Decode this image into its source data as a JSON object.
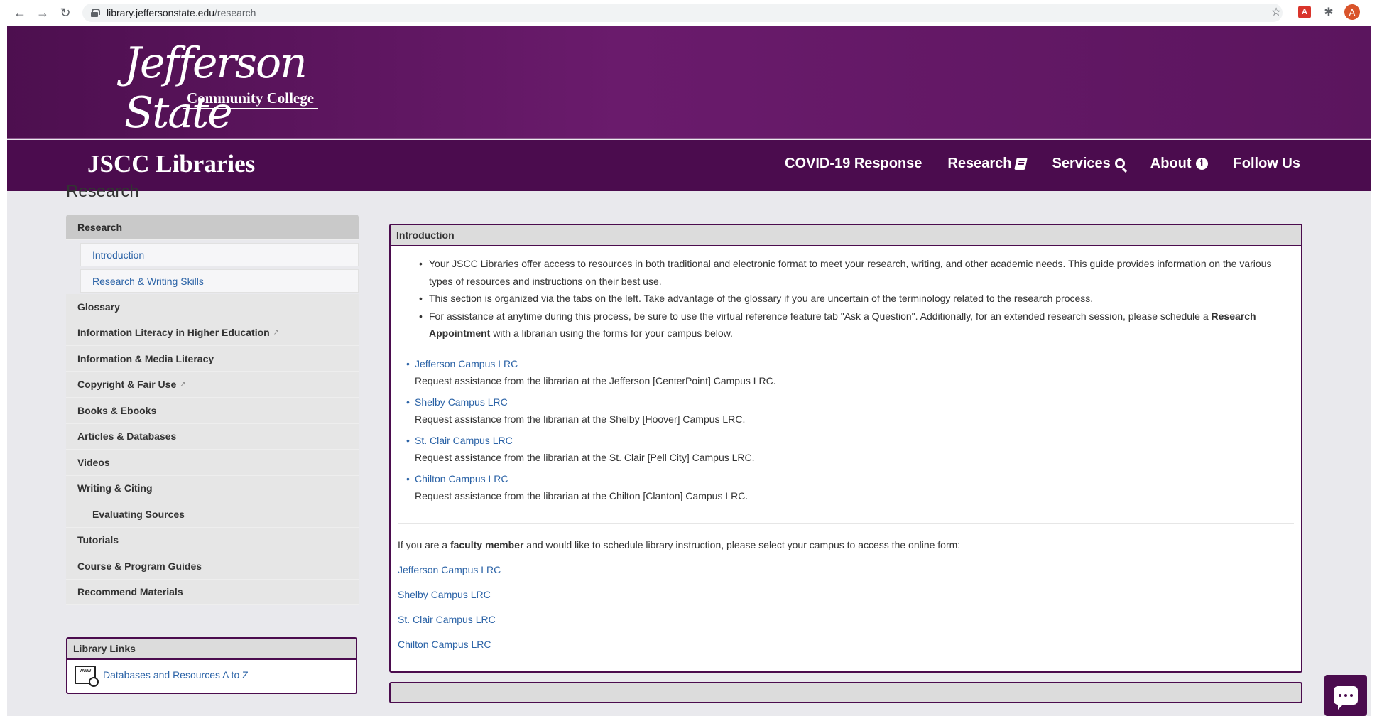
{
  "browser": {
    "url_host": "library.jeffersonstate.edu",
    "url_path": "/research",
    "back_icon": "arrow-left-icon",
    "forward_icon": "arrow-right-icon",
    "reload_icon": "reload-icon",
    "avatar_letter": "A",
    "pdf_ext": "A"
  },
  "header": {
    "logo_script": "Jefferson State",
    "logo_sub": "Community College",
    "brand": "JSCC Libraries",
    "nav": [
      {
        "label": "COVID-19 Response"
      },
      {
        "label": "Research"
      },
      {
        "label": "Services"
      },
      {
        "label": "About"
      },
      {
        "label": "Follow Us"
      }
    ],
    "brand_color": "#4b0c4e"
  },
  "page": {
    "title": "Research"
  },
  "sidenav": {
    "items": [
      {
        "label": "Research"
      },
      {
        "label": "Introduction"
      },
      {
        "label": "Research & Writing Skills"
      },
      {
        "label": "Glossary"
      },
      {
        "label": "Information Literacy in Higher Education"
      },
      {
        "label": "Information & Media Literacy"
      },
      {
        "label": "Copyright & Fair Use"
      },
      {
        "label": "Books & Ebooks"
      },
      {
        "label": "Articles & Databases"
      },
      {
        "label": "Videos"
      },
      {
        "label": "Writing & Citing"
      },
      {
        "label": "Evaluating Sources"
      },
      {
        "label": "Tutorials"
      },
      {
        "label": "Course & Program Guides"
      },
      {
        "label": "Recommend Materials"
      }
    ]
  },
  "library_links": {
    "title": "Library Links",
    "items": [
      {
        "label": "Databases and Resources A to Z",
        "icon_text": "www"
      }
    ]
  },
  "intro": {
    "title": "Introduction",
    "bullets": [
      "Your JSCC Libraries offer access to resources in both traditional and electronic format to meet your research, writing, and other academic needs.  This guide provides information on the various types of resources and instructions on their best use.",
      "This section is organized via the tabs on the left.  Take advantage of the glossary if you are uncertain of the terminology related to the research process."
    ],
    "bullet3_pre": "For assistance at anytime during this process, be sure to use the virtual reference feature tab \"Ask a Question\".  Additionally, for an extended research session, please schedule a ",
    "bullet3_bold": "Research Appointment",
    "bullet3_post": " with a librarian using the forms for your campus below.",
    "campuses": [
      {
        "link": "Jefferson Campus LRC",
        "desc": "Request assistance from the librarian at the Jefferson [CenterPoint] Campus LRC."
      },
      {
        "link": "Shelby Campus LRC",
        "desc": "Request assistance from the librarian at the Shelby [Hoover] Campus LRC."
      },
      {
        "link": "St. Clair Campus LRC",
        "desc": "Request assistance from the librarian at the St. Clair [Pell City] Campus LRC."
      },
      {
        "link": "Chilton Campus LRC",
        "desc": "Request assistance from the librarian at the Chilton [Clanton] Campus LRC."
      }
    ],
    "faculty_pre": "If you are a ",
    "faculty_bold": "faculty member",
    "faculty_post": " and would like to schedule library instruction, please select your campus to access the online form:",
    "faculty_links": [
      {
        "label": "Jefferson Campus LRC"
      },
      {
        "label": "Shelby Campus LRC"
      },
      {
        "label": "St. Clair Campus LRC"
      },
      {
        "label": "Chilton Campus LRC"
      }
    ]
  }
}
